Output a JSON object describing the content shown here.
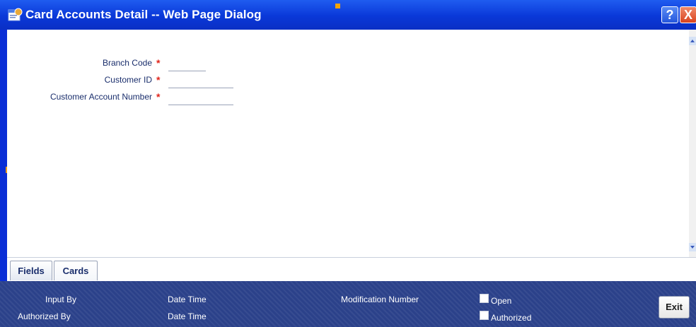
{
  "window": {
    "title": "Card Accounts Detail -- Web Page Dialog",
    "help_label": "?",
    "close_label": "X"
  },
  "form": {
    "required_mark": "*",
    "fields": [
      {
        "label": "Branch Code",
        "value": ""
      },
      {
        "label": "Customer ID",
        "value": ""
      },
      {
        "label": "Customer Account Number",
        "value": ""
      }
    ]
  },
  "tabs": [
    {
      "label": "Fields"
    },
    {
      "label": "Cards"
    }
  ],
  "footer": {
    "input_by": "Input By",
    "authorized_by": "Authorized By",
    "date_time_1": "Date Time",
    "date_time_2": "Date Time",
    "modification_number": "Modification Number",
    "open_label": "Open",
    "authorized_label": "Authorized",
    "exit_label": "Exit"
  },
  "colors": {
    "titlebar": "#0a38d8",
    "footer": "#2b418a",
    "label_text": "#1a2e6c",
    "required": "#e0251b"
  }
}
